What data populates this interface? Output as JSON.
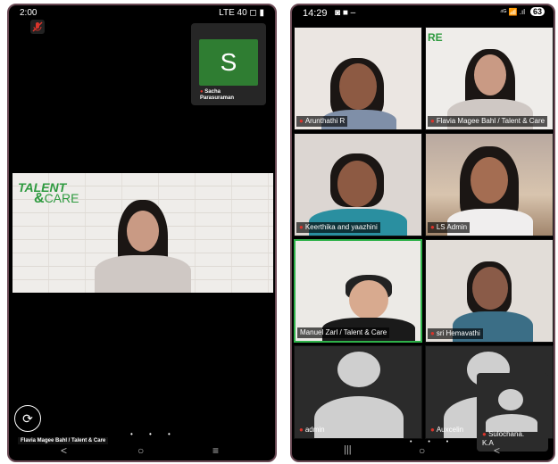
{
  "left_phone": {
    "status_bar": {
      "time": "2:00",
      "right": "LTE 40 ◻ ▮"
    },
    "thumbnail": {
      "avatar_letter": "S",
      "name_line1": "Sacha",
      "name_line2": "Parasuraman"
    },
    "speaker": {
      "brand_line1": "TALENT",
      "brand_amp": "&",
      "brand_line2": "CARE",
      "name": "Flavia Magee Bahl / Talent & Care"
    },
    "nav": {
      "back": "<",
      "home": "○",
      "menu": "≡"
    }
  },
  "right_phone": {
    "status_bar": {
      "time": "14:29",
      "icons": "◙ ■ –",
      "right": "⁴ᴳ 📶 .ıl",
      "battery": "63"
    },
    "tiles": [
      {
        "name": "Arunthathi R",
        "muted": true
      },
      {
        "name": "Flavia Magee Bahl / Talent & Care",
        "muted": true
      },
      {
        "name": "Keerthika and yaazhini",
        "muted": true
      },
      {
        "name": "LS Admin",
        "muted": true
      },
      {
        "name": "Manuel Zarl / Talent & Care",
        "muted": false
      },
      {
        "name": "sri Hemavathi",
        "muted": true
      },
      {
        "name": "admin",
        "muted": true
      },
      {
        "name": "Auxcelin",
        "muted": true
      }
    ],
    "pip": {
      "name_line1": "Sulochana.",
      "name_line2": "K.A"
    },
    "nav": {
      "recents": "|||",
      "home": "○",
      "back": "<"
    }
  },
  "colors": {
    "brand_green": "#2e9a3f",
    "active_border": "#2fb24a",
    "muted_red": "#d9342b",
    "frame": "#6b4a55"
  }
}
